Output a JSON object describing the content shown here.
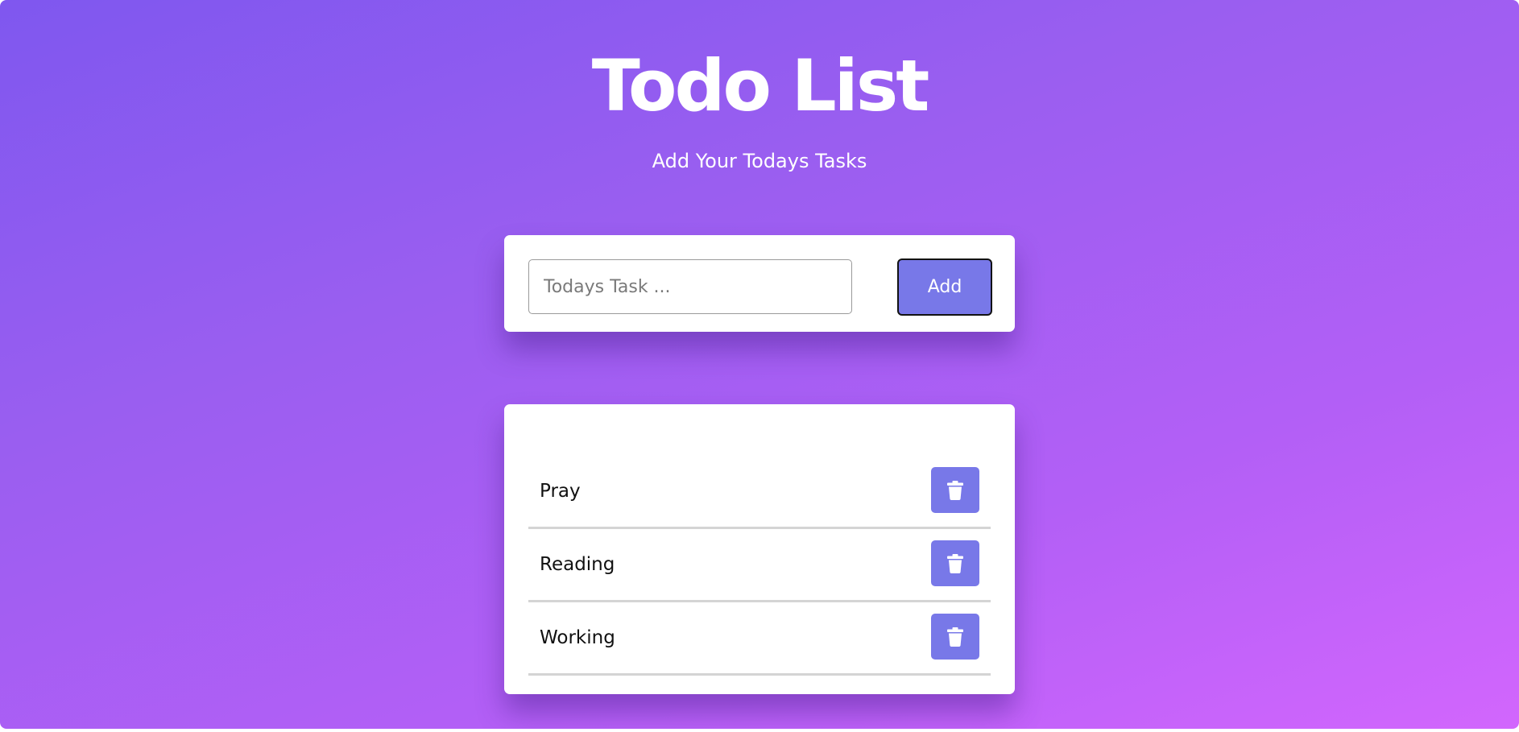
{
  "header": {
    "title": "Todo List",
    "subtitle": "Add Your Todays Tasks"
  },
  "form": {
    "input_value": "",
    "input_placeholder": "Todays Task ...",
    "add_label": "Add"
  },
  "tasks": [
    {
      "label": "Pray",
      "delete_icon": "trash-icon"
    },
    {
      "label": "Reading",
      "delete_icon": "trash-icon"
    },
    {
      "label": "Working",
      "delete_icon": "trash-icon"
    }
  ],
  "colors": {
    "gradient_start": "#7f57ef",
    "gradient_end": "#d266fd",
    "button": "#7878e8",
    "card": "#ffffff",
    "text_light": "#ffffff",
    "text_dark": "#111111"
  }
}
